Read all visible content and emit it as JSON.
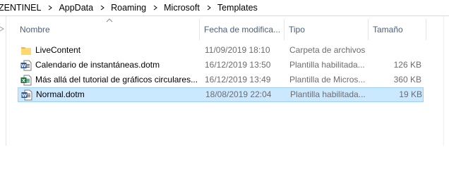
{
  "breadcrumb": {
    "segments": [
      "ZENTINEL",
      "AppData",
      "Roaming",
      "Microsoft",
      "Templates"
    ],
    "separator_icon": "chevron-right-icon"
  },
  "columns": {
    "name": "Nombre",
    "date": "Fecha de modifica...",
    "type": "Tipo",
    "size": "Tamaño",
    "sort_icon": "sort-ascending-icon"
  },
  "files": [
    {
      "name": "LiveContent",
      "date": "11/09/2019 18:10",
      "type": "Carpeta de archivos",
      "size": "",
      "icon": "folder-icon"
    },
    {
      "name": "Calendario de instantáneas.dotm",
      "date": "16/12/2019 13:50",
      "type": "Plantilla habilitada...",
      "size": "126 KB",
      "icon": "word-template-icon"
    },
    {
      "name": "Más allá del tutorial de gráficos circulares...",
      "date": "16/12/2019 13:49",
      "type": "Plantilla de Micros...",
      "size": "360 KB",
      "icon": "excel-template-icon"
    },
    {
      "name": "Normal.dotm",
      "date": "18/08/2019 22:04",
      "type": "Plantilla habilitada...",
      "size": "19 KB",
      "icon": "word-template-icon",
      "selected": true
    }
  ],
  "colors": {
    "selection_bg": "#cce8ff",
    "selection_border": "#99d1ff",
    "header_text": "#4c607a",
    "folder_yellow": "#ffd96b",
    "word_blue": "#2b579a",
    "excel_green": "#217346"
  }
}
